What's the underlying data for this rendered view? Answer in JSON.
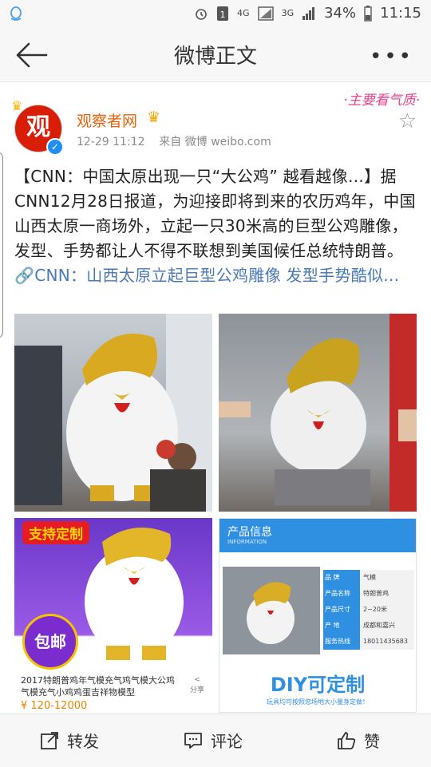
{
  "status": {
    "signal1": "4G",
    "signal2": "3G",
    "battery": "34%",
    "time": "11:15"
  },
  "nav": {
    "title": "微博正文",
    "more": "•••"
  },
  "post": {
    "author": "观察者网",
    "avatar_text": "观",
    "date": "12-29 11:12",
    "source": "来自 微博 weibo.com",
    "tag": "·主要看气质·",
    "text_main": "【CNN：中国太原出现一只“大公鸡” 越看越像…】据CNN12月28日报道，为迎接即将到来的农历鸡年，中国山西太原一商场外，立起一只30米高的巨型公鸡雕像，发型、手势都让人不得不联想到美国候任总统特朗普。",
    "link_text": "🔗CNN：山西太原立起巨型公鸡雕像 发型手势酷似..."
  },
  "images": {
    "img3": {
      "badge": "支持定制",
      "circle": "包邮",
      "desc": "2017特朗普鸡年气模充气鸡气模大公鸡气模充气小鸡鸡蛋吉祥物模型",
      "price": "¥ 120-12000",
      "share": "分享"
    },
    "img4": {
      "title": "产品信息",
      "subtitle": "INFORMATION",
      "rows": [
        {
          "k": "品 牌",
          "v": "气模"
        },
        {
          "k": "产品名称",
          "v": "特朗普鸡"
        },
        {
          "k": "产品尺寸",
          "v": "2~20米"
        },
        {
          "k": "产 地",
          "v": "成都和嘉兴"
        },
        {
          "k": "服务热线",
          "v": "18011435683"
        }
      ],
      "diy": "DIY可定制",
      "diy_sub": "玩具均可按照您场地大小量身定做！"
    }
  },
  "actions": {
    "repost": "转发",
    "comment": "评论",
    "like": "赞"
  },
  "colors": {
    "author": "#e8630a",
    "link": "#4a7ab5",
    "accent_blue": "#2f8fe1"
  }
}
